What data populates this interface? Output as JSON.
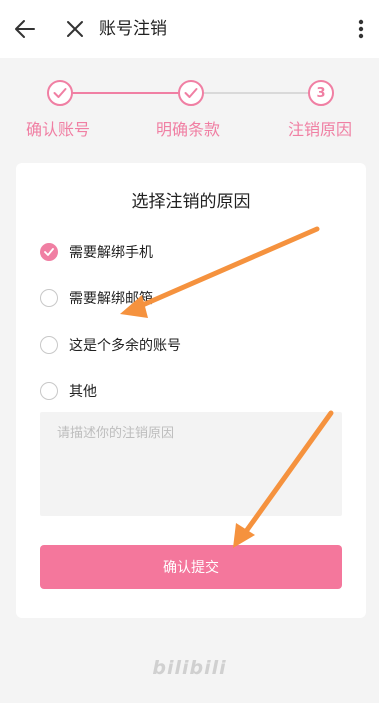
{
  "header": {
    "title": "账号注销"
  },
  "steps": [
    {
      "label": "确认账号",
      "state": "done"
    },
    {
      "label": "明确条款",
      "state": "done"
    },
    {
      "label": "注销原因",
      "state": "current",
      "number": "3"
    }
  ],
  "card": {
    "title": "选择注销的原因",
    "options": [
      {
        "label": "需要解绑手机",
        "checked": true
      },
      {
        "label": "需要解绑邮箱",
        "checked": false
      },
      {
        "label": "这是个多余的账号",
        "checked": false
      },
      {
        "label": "其他",
        "checked": false
      }
    ],
    "reason_placeholder": "请描述你的注销原因",
    "reason_value": "",
    "submit_label": "确认提交"
  },
  "footer": {
    "logo_text": "bilibili"
  },
  "colors": {
    "accent": "#f07fa3",
    "button": "#f4779c",
    "annotation_arrow": "#f5923e"
  }
}
